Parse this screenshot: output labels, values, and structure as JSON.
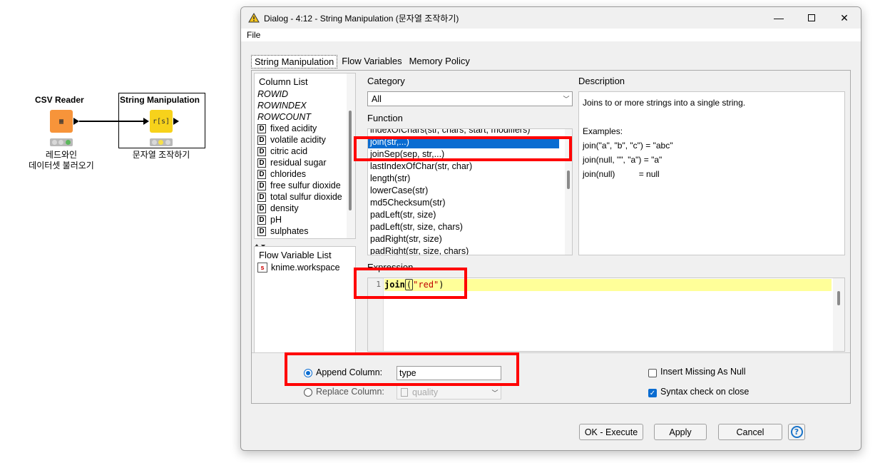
{
  "workflow": {
    "csv_reader": {
      "title": "CSV Reader",
      "icon_text": "▦",
      "label_line1": "레드와인",
      "label_line2": "데이터셋 불러오기"
    },
    "string_manip": {
      "title": "String Manipulation",
      "icon_text": "r[s]",
      "label": "문자열 조작하기"
    }
  },
  "dialog": {
    "title": "Dialog - 4:12 - String Manipulation (문자열 조작하기)",
    "menu_file": "File",
    "tabs": [
      {
        "label": "String Manipulation"
      },
      {
        "label": "Flow Variables"
      },
      {
        "label": "Memory Policy"
      }
    ],
    "column_list": {
      "header": "Column List",
      "special": [
        "ROWID",
        "ROWINDEX",
        "ROWCOUNT"
      ],
      "columns": [
        {
          "type": "D",
          "name": "fixed acidity"
        },
        {
          "type": "D",
          "name": "volatile acidity"
        },
        {
          "type": "D",
          "name": "citric acid"
        },
        {
          "type": "D",
          "name": "residual sugar"
        },
        {
          "type": "D",
          "name": "chlorides"
        },
        {
          "type": "D",
          "name": "free sulfur dioxide"
        },
        {
          "type": "D",
          "name": "total sulfur dioxide"
        },
        {
          "type": "D",
          "name": "density"
        },
        {
          "type": "D",
          "name": "pH"
        },
        {
          "type": "D",
          "name": "sulphates"
        }
      ]
    },
    "flow_variable_list": {
      "header": "Flow Variable List",
      "items": [
        {
          "badge": "s",
          "name": "knime.workspace"
        }
      ]
    },
    "category": {
      "label": "Category",
      "value": "All"
    },
    "function": {
      "label": "Function",
      "items": [
        "indexOfChars(str, chars, start, modifiers)",
        "join(str,...)",
        "joinSep(sep, str,...)",
        "lastIndexOfChar(str, char)",
        "length(str)",
        "lowerCase(str)",
        "md5Checksum(str)",
        "padLeft(str, size)",
        "padLeft(str, size, chars)",
        "padRight(str, size)",
        "padRight(str, size, chars)"
      ],
      "selected_index": 1
    },
    "description": {
      "label": "Description",
      "lines": [
        "Joins to or more strings into a single string.",
        "",
        "Examples:",
        "join(\"a\", \"b\", \"c\") = \"abc\"",
        "join(null, \"\", \"a\") = \"a\"",
        "join(null)          = null"
      ]
    },
    "expression": {
      "label": "Expression",
      "line_number": "1",
      "fn": "join",
      "paren_open": "(",
      "arg": "\"red\"",
      "paren_close": ")"
    },
    "options": {
      "append_label": "Append Column:",
      "append_value": "type",
      "replace_label": "Replace Column:",
      "replace_value": "quality",
      "insert_missing_label": "Insert Missing As Null",
      "syntax_check_label": "Syntax check on close"
    },
    "buttons": {
      "ok": "OK - Execute",
      "apply": "Apply",
      "cancel": "Cancel",
      "help": "?"
    }
  },
  "colors": {
    "selection_blue": "#0a6cd1",
    "highlight_red": "#ff0000",
    "csv_icon_orange": "#f7943a",
    "manip_icon_yellow": "#f7d21b",
    "expression_line_yellow": "#ffff99"
  }
}
